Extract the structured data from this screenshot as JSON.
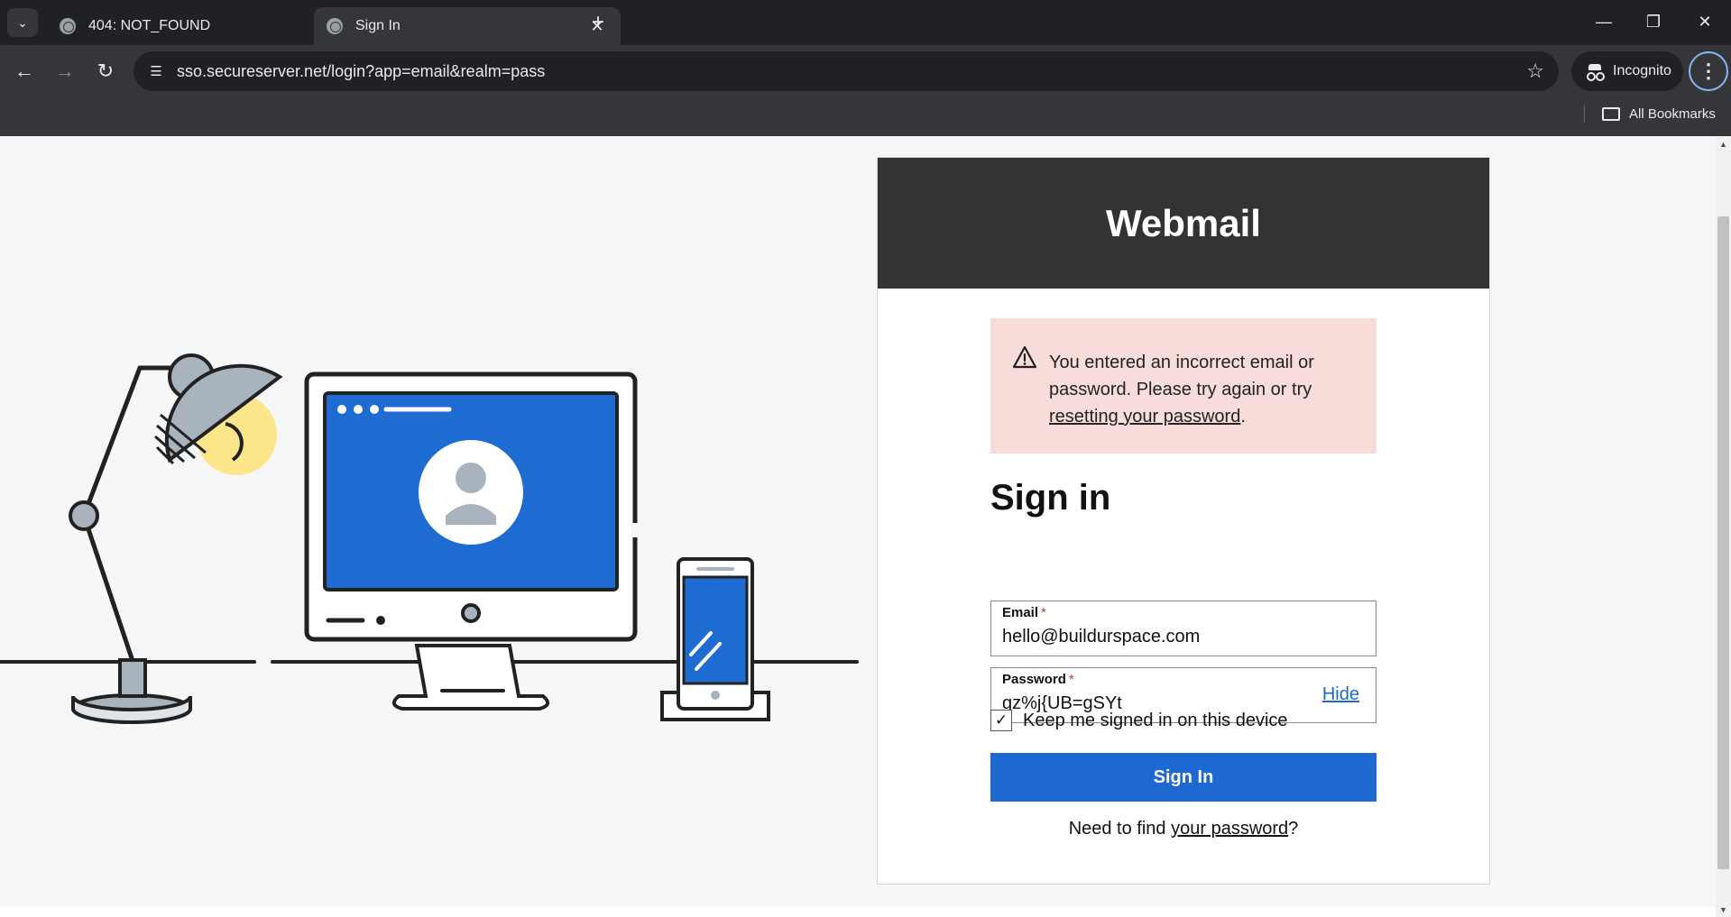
{
  "browser": {
    "tabs": [
      {
        "title": "404: NOT_FOUND",
        "active": false
      },
      {
        "title": "Sign In",
        "active": true
      }
    ],
    "url": "sso.secureserver.net/login?app=email&realm=pass",
    "incognito_label": "Incognito",
    "bookmarks_label": "All Bookmarks"
  },
  "card": {
    "header_title": "Webmail",
    "alert": {
      "text": "You entered an incorrect email or password. Please try again or try ",
      "link_text": "resetting your password",
      "suffix": "."
    },
    "signin_title": "Sign in",
    "email": {
      "label": "Email",
      "required_marker": "*",
      "value": "hello@buildurspace.com"
    },
    "password": {
      "label": "Password",
      "required_marker": "*",
      "value": "gz%j{UB=gSYt",
      "toggle_label": "Hide"
    },
    "keep_signed_in": {
      "label": "Keep me signed in on this device",
      "checked": true
    },
    "submit_label": "Sign In",
    "find_password": {
      "prefix": "Need to find ",
      "link_text": "your password",
      "suffix": "?"
    }
  },
  "colors": {
    "header_bg": "#333333",
    "button_blue": "#1d69d1",
    "alert_bg": "#f8dcda",
    "illustration_blue": "#1e6bd1",
    "lamp_yellow": "#fde68a"
  }
}
